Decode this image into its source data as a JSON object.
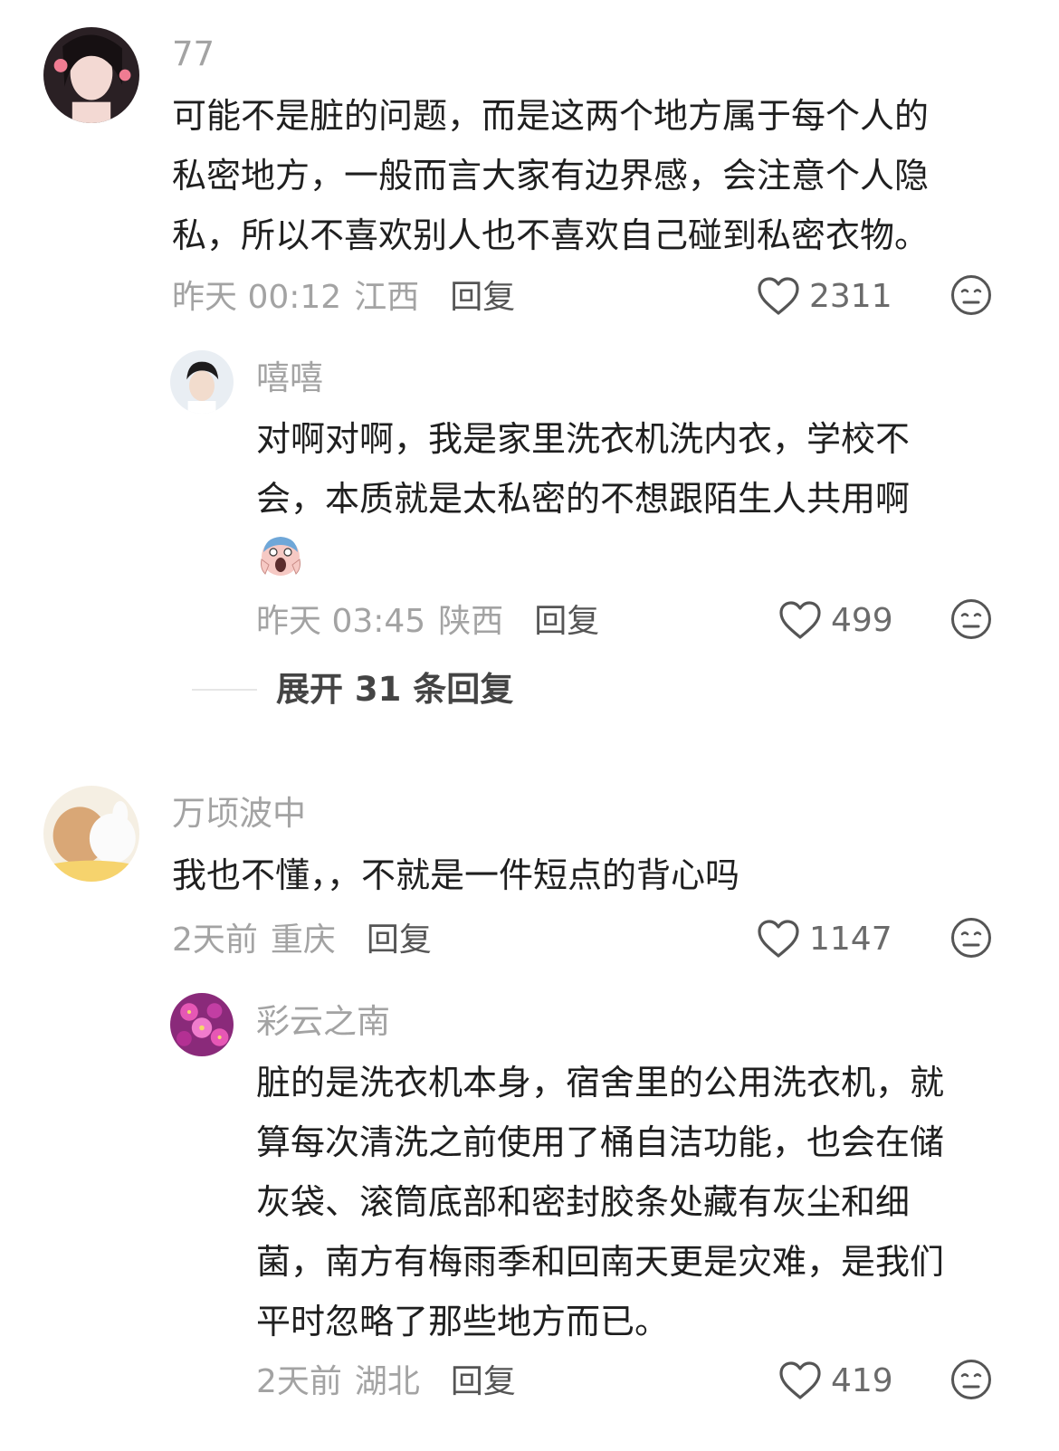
{
  "comments": [
    {
      "username": "77",
      "lines": [
        "可能不是脏的问题，而是这两个地方属于每个人的",
        "私密地方，一般而言大家有边界感，会注意个人隐",
        "私，所以不喜欢别人也不喜欢自己碰到私密衣物。"
      ],
      "time": "昨天 00:12",
      "location": "江西",
      "reply_label": "回复",
      "likes": "2311",
      "replies": [
        {
          "username": "嘻嘻",
          "lines": [
            "对啊对啊，我是家里洗衣机洗内衣，学校不",
            "会，本质就是太私密的不想跟陌生人共用啊"
          ],
          "emoji": "scream-emoji",
          "time": "昨天 03:45",
          "location": "陕西",
          "reply_label": "回复",
          "likes": "499"
        }
      ],
      "expand_label": "展开 31 条回复"
    },
    {
      "username": "万顷波中",
      "lines": [
        "我也不懂，，不就是一件短点的背心吗"
      ],
      "time": "2天前",
      "location": "重庆",
      "reply_label": "回复",
      "likes": "1147",
      "replies": [
        {
          "username": "彩云之南",
          "lines": [
            "脏的是洗衣机本身，宿舍里的公用洗衣机，就",
            "算每次清洗之前使用了桶自洁功能，也会在储",
            "灰袋、滚筒底部和密封胶条处藏有灰尘和细",
            "菌，南方有梅雨季和回南天更是灾难，是我们",
            "平时忽略了那些地方而已。"
          ],
          "time": "2天前",
          "location": "湖北",
          "reply_label": "回复",
          "likes": "419"
        }
      ]
    }
  ],
  "icons": {
    "like": "heart-outline-icon",
    "dislike": "meh-face-icon"
  },
  "colors": {
    "text_primary": "#1f1f1f",
    "text_secondary": "#a3a3a3",
    "reply_text": "#555555",
    "icon": "#555555"
  }
}
